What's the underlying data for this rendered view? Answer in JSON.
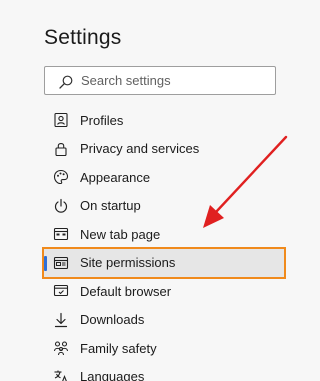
{
  "header": {
    "title": "Settings"
  },
  "search": {
    "placeholder": "Search settings",
    "icon": "search-icon"
  },
  "nav": {
    "items": [
      {
        "label": "Profiles",
        "icon": "profile-icon"
      },
      {
        "label": "Privacy and services",
        "icon": "lock-icon"
      },
      {
        "label": "Appearance",
        "icon": "palette-icon"
      },
      {
        "label": "On startup",
        "icon": "power-icon"
      },
      {
        "label": "New tab page",
        "icon": "new-tab-icon"
      },
      {
        "label": "Site permissions",
        "icon": "site-permissions-icon",
        "selected": true
      },
      {
        "label": "Default browser",
        "icon": "default-browser-icon"
      },
      {
        "label": "Downloads",
        "icon": "download-icon"
      },
      {
        "label": "Family safety",
        "icon": "family-icon"
      },
      {
        "label": "Languages",
        "icon": "languages-icon"
      }
    ]
  },
  "colors": {
    "highlight_border": "#f08a1c",
    "selected_indicator": "#2f6fd6",
    "annotation_arrow": "#e02020",
    "background": "#f7f7f7"
  }
}
